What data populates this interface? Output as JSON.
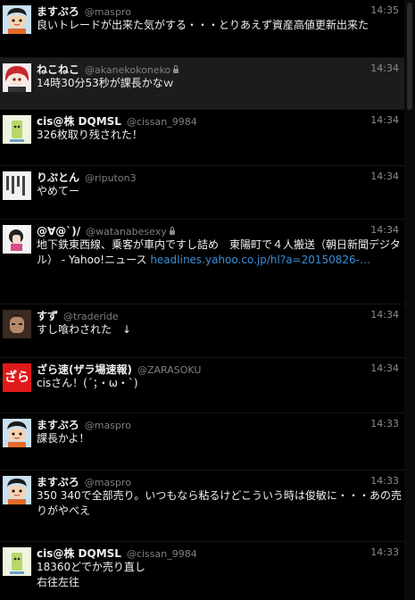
{
  "tweets": [
    {
      "name": "ますぷろ",
      "handle": "@maspro",
      "locked": false,
      "time": "14:35",
      "text": "良いトレードが出来た気がする・・・とりあえず資産高値更新出来た",
      "avatar": "maspro-avatar"
    },
    {
      "name": "ねこねこ",
      "handle": "@akanekokoneko",
      "locked": true,
      "time": "14:34",
      "text": "14時30分53秒が課長かなｗ",
      "avatar": "nekoneko-avatar"
    },
    {
      "name": "cis@株 DQMSL",
      "handle": "@cissan_9984",
      "locked": false,
      "time": "14:34",
      "text": "326枚取り残された！",
      "avatar": "cis-avatar"
    },
    {
      "name": "りぷとん",
      "handle": "@riputon3",
      "locked": false,
      "time": "14:34",
      "text": "やめてー",
      "avatar": "riputon-avatar"
    },
    {
      "name": "@∀@`)/",
      "handle": "@watanabesexy",
      "locked": true,
      "time": "14:34",
      "text": "地下鉄東西線、乗客が車内ですし詰め　東陽町で４人搬送（朝日新聞デジタル） - Yahoo!ニュース ",
      "link": "headlines.yahoo.co.jp/hl?a=20150826-…",
      "avatar": "watanabe-avatar"
    },
    {
      "name": "すず",
      "handle": "@traderide",
      "locked": false,
      "time": "14:34",
      "text": "すし喰わされた　↓",
      "avatar": "suzu-avatar"
    },
    {
      "name": "ざら速(ザラ場速報)",
      "handle": "@ZARASOKU",
      "locked": false,
      "time": "14:34",
      "text": "cisさん！(´；・ω・`)",
      "avatar": "zarasoku-avatar",
      "avatar_text": "ざら"
    },
    {
      "name": "ますぷろ",
      "handle": "@maspro",
      "locked": false,
      "time": "14:33",
      "text": "課長かよ！",
      "avatar": "maspro-avatar"
    },
    {
      "name": "ますぷろ",
      "handle": "@maspro",
      "locked": false,
      "time": "14:33",
      "text": "350 340で全部売り。いつもなら粘るけどこういう時は俊敏に・・・あの売りがやべえ",
      "avatar": "maspro-avatar"
    },
    {
      "name": "cis@株 DQMSL",
      "handle": "@cissan_9984",
      "locked": false,
      "time": "14:33",
      "text": "18360どでか売り直し\n右往左往",
      "avatar": "cis-avatar"
    }
  ]
}
